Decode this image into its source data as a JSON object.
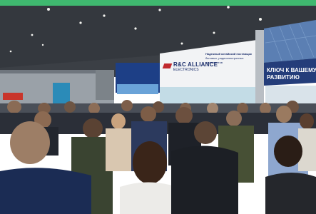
{
  "photo": {
    "frame_color": "#3fb86f",
    "booths": {
      "center": {
        "brand": "R&C ALLIANCE",
        "brand_sub": "ELECTRONICS",
        "tagline_line1": "Надежный китайский поставщик",
        "tagline_line2": "бытовых, радиоэлектронных",
        "tagline_line3": "компонентов"
      },
      "right": {
        "slogan_line1": "КЛЮЧ К ВАШЕМУ",
        "slogan_line2": "РАЗВИТИЮ"
      }
    },
    "colors": {
      "ceiling": "#3b3f45",
      "crowd_dark": "#1f2229",
      "booth_blue": "#1d3f86",
      "slogan_panel": "#243d7a"
    }
  }
}
